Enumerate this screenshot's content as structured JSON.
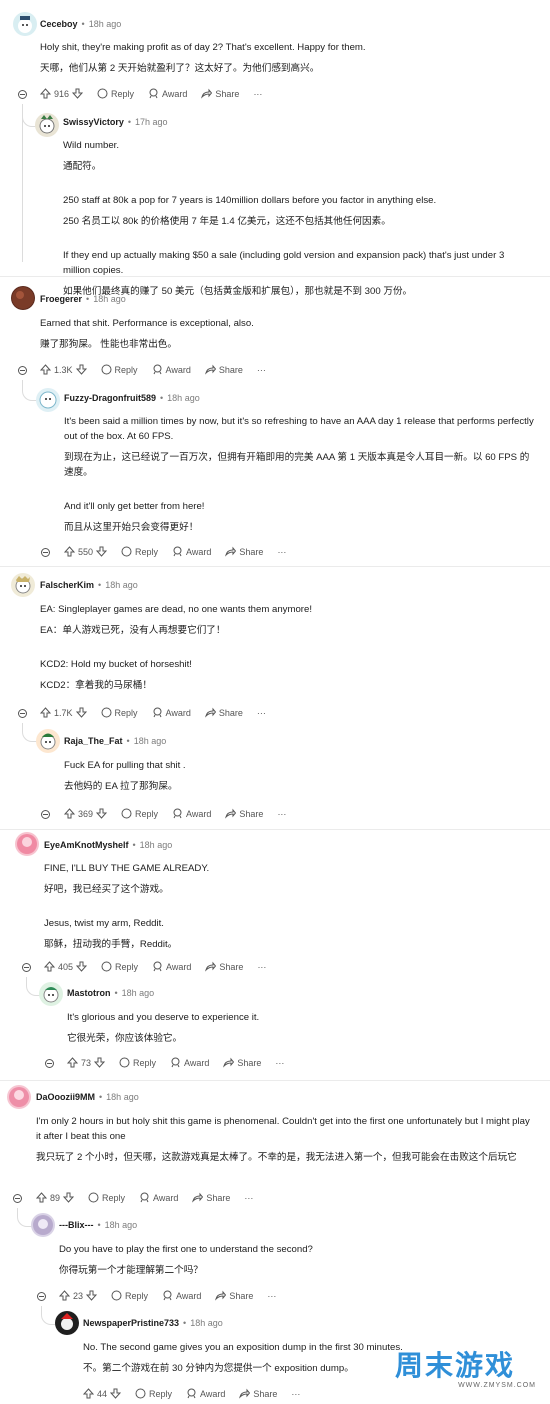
{
  "actions": {
    "reply": "Reply",
    "award": "Award",
    "share": "Share",
    "more": "···"
  },
  "comments": [
    {
      "user": "Ceceboy",
      "time": "18h ago",
      "en": "Holy shit, they're making profit as of day 2? That's excellent. Happy for them.",
      "zh": "天哪，他们从第 2 天开始就盈利了？这太好了。为他们感到高兴。",
      "votes": "916"
    },
    {
      "user": "SwissyVictory",
      "time": "17h ago",
      "en": "Wild number.",
      "zh": "通配符。",
      "en2": "250 staff at 80k a pop for 7 years is 140million dollars before you factor in anything else.",
      "zh2": "250 名员工以 80k 的价格使用 7 年是 1.4 亿美元，这还不包括其他任何因素。",
      "en3": "If they end up actually making $50 a sale (including gold version and expansion pack) that's just under 3 million copies.",
      "zh3": "如果他们最终真的赚了 50 美元（包括黄金版和扩展包），那也就是不到 300 万份。"
    },
    {
      "user": "Froegerer",
      "time": "18h ago",
      "en": "Earned that shit. Performance is exceptional, also.",
      "zh": "赚了那狗屎。 性能也非常出色。",
      "votes": "1.3K"
    },
    {
      "user": "Fuzzy-Dragonfruit589",
      "time": "18h ago",
      "en": "It's been said a million times by now, but it's so refreshing to have an AAA day 1 release that performs perfectly out of the box. At 60 FPS.",
      "zh": "到现在为止，这已经说了一百万次，但拥有开箱即用的完美 AAA 第 1 天版本真是令人耳目一新。以 60 FPS 的速度。",
      "en2": "And it'll only get better from here!",
      "zh2": "而且从这里开始只会变得更好！",
      "votes": "550"
    },
    {
      "user": "FalscherKim",
      "time": "18h ago",
      "en": "EA: Singleplayer games are dead, no one wants them anymore!",
      "zh": "EA：单人游戏已死，没有人再想要它们了！",
      "en2": "KCD2: Hold my bucket of horseshit!",
      "zh2": "KCD2：拿着我的马尿桶！",
      "votes": "1.7K"
    },
    {
      "user": "Raja_The_Fat",
      "time": "18h ago",
      "en": "Fuck EA for pulling that shit .",
      "zh": "去他妈的 EA 拉了那狗屎。",
      "votes": "369"
    },
    {
      "user": "EyeAmKnotMyshelf",
      "time": "18h ago",
      "en": "FINE, I'LL BUY THE GAME ALREADY.",
      "zh": "好吧，我已经买了这个游戏。",
      "en2": "Jesus, twist my arm, Reddit.",
      "zh2": "耶稣，扭动我的手臂，Reddit。",
      "votes": "405"
    },
    {
      "user": "Mastotron",
      "time": "18h ago",
      "en": "It's glorious and you deserve to experience it.",
      "zh": "它很光荣，你应该体验它。",
      "votes": "73"
    },
    {
      "user": "DaOoozii9MM",
      "time": "18h ago",
      "en": "I'm only 2 hours in but holy shit this game is phenomenal. Couldn't get into the first one unfortunately but I might play it after I beat this one",
      "zh": "我只玩了 2 个小时，但天哪，这款游戏真是太棒了。不幸的是，我无法进入第一个，但我可能会在击败这个后玩它",
      "votes": "89"
    },
    {
      "user": "---Blix---",
      "time": "18h ago",
      "en": "Do you have to play the first one to understand the second?",
      "zh": "你得玩第一个才能理解第二个吗？",
      "votes": "23"
    },
    {
      "user": "NewspaperPristine733",
      "time": "18h ago",
      "en": "No. The second game gives you an exposition dump in the first 30 minutes.",
      "zh": "不。第二个游戏在前 30 分钟内为您提供一个 exposition dump。",
      "votes": "44"
    }
  ],
  "watermark": {
    "title": "周末游戏",
    "url": "WWW.ZMYSM.COM"
  }
}
